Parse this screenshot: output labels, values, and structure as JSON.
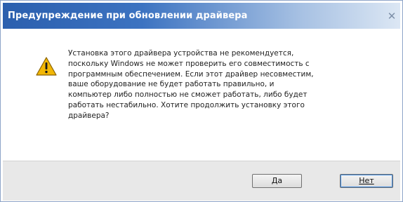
{
  "window": {
    "title": "Предупреждение при обновлении драйвера",
    "close_glyph": "✕"
  },
  "icon": {
    "name": "warning-icon",
    "color": "#f2b705"
  },
  "message": {
    "text": "Установка этого драйвера устройства не рекомендуется,\nпоскольку Windows не может проверить его совместимость с\nпрограммным обеспечением. Если этот драйвер несовместим,\nваше оборудование не будет работать правильно, и\nкомпьютер либо полностью не сможет работать, либо будет\nработать нестабильно. Хотите продолжить установку этого\nдрайвера?"
  },
  "buttons": {
    "yes_label": "Да",
    "no_label": "Нет"
  }
}
